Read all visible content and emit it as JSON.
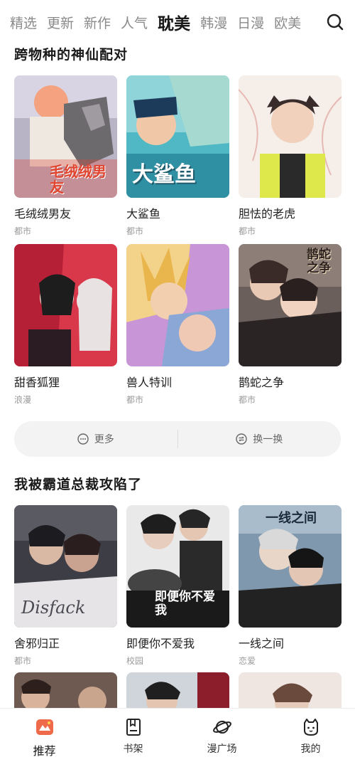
{
  "tabs": [
    "精选",
    "更新",
    "新作",
    "人气",
    "耽美",
    "韩漫",
    "日漫",
    "欧美"
  ],
  "active_tab": "耽美",
  "section1": {
    "title": "跨物种的神仙配对",
    "items": [
      {
        "title": "毛绒绒男友",
        "tag": "都市",
        "cover_text": "毛绒绒男友"
      },
      {
        "title": "大鲨鱼",
        "tag": "都市",
        "cover_text": "大鲨鱼"
      },
      {
        "title": "胆怯的老虎",
        "tag": "都市",
        "cover_text": ""
      },
      {
        "title": "甜香狐狸",
        "tag": "浪漫",
        "cover_text": ""
      },
      {
        "title": "兽人特训",
        "tag": "都市",
        "cover_text": ""
      },
      {
        "title": "鹊蛇之争",
        "tag": "都市",
        "cover_text": "鹊蛇之争"
      }
    ]
  },
  "actions": {
    "more": "更多",
    "refresh": "换一换"
  },
  "section2": {
    "title": "我被霸道总裁攻陷了",
    "items": [
      {
        "title": "舍邪归正",
        "tag": "都市",
        "cover_text": "Disfack"
      },
      {
        "title": "即便你不爱我",
        "tag": "校园",
        "cover_text": "即便你不爱我"
      },
      {
        "title": "一线之间",
        "tag": "恋爱",
        "cover_text": "一线之间"
      }
    ]
  },
  "bottom_nav": [
    {
      "label": "推荐",
      "icon": "recommend-icon",
      "active": true
    },
    {
      "label": "书架",
      "icon": "bookshelf-icon",
      "active": false
    },
    {
      "label": "漫广场",
      "icon": "planet-icon",
      "active": false
    },
    {
      "label": "我的",
      "icon": "profile-cat-icon",
      "active": false
    }
  ],
  "colors": {
    "accent": "#e0533b",
    "text": "#1a1a1a",
    "muted": "#9a9a9a"
  }
}
